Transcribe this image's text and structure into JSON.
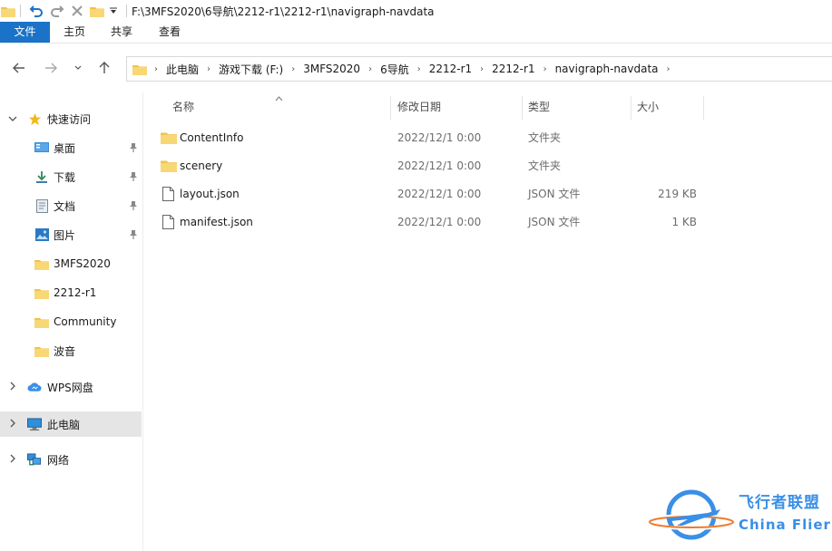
{
  "window": {
    "title_path": "F:\\3MFS2020\\6导航\\2212-r1\\2212-r1\\navigraph-navdata"
  },
  "ribbon": {
    "tabs": [
      {
        "label": "文件"
      },
      {
        "label": "主页"
      },
      {
        "label": "共享"
      },
      {
        "label": "查看"
      }
    ]
  },
  "address": {
    "breadcrumbs": [
      "此电脑",
      "游戏下载 (F:)",
      "3MFS2020",
      "6导航",
      "2212-r1",
      "2212-r1",
      "navigraph-navdata"
    ]
  },
  "sidebar": {
    "quick_access": "快速访问",
    "items": [
      {
        "label": "桌面",
        "icon": "desktop-icon",
        "pinned": true
      },
      {
        "label": "下载",
        "icon": "download-icon",
        "pinned": true
      },
      {
        "label": "文档",
        "icon": "document-icon",
        "pinned": true
      },
      {
        "label": "图片",
        "icon": "picture-icon",
        "pinned": true
      },
      {
        "label": "3MFS2020",
        "icon": "folder-icon",
        "pinned": false
      },
      {
        "label": "2212-r1",
        "icon": "folder-icon",
        "pinned": false
      },
      {
        "label": "Community",
        "icon": "folder-icon",
        "pinned": false
      },
      {
        "label": "波音",
        "icon": "folder-icon",
        "pinned": false
      }
    ],
    "wps": "WPS网盘",
    "this_pc": "此电脑",
    "network": "网络"
  },
  "filelist": {
    "columns": {
      "name": "名称",
      "date": "修改日期",
      "type": "类型",
      "size": "大小"
    },
    "rows": [
      {
        "name": "ContentInfo",
        "date": "2022/12/1 0:00",
        "type": "文件夹",
        "size": "",
        "icon": "folder-icon"
      },
      {
        "name": "scenery",
        "date": "2022/12/1 0:00",
        "type": "文件夹",
        "size": "",
        "icon": "folder-icon"
      },
      {
        "name": "layout.json",
        "date": "2022/12/1 0:00",
        "type": "JSON 文件",
        "size": "219 KB",
        "icon": "file-icon"
      },
      {
        "name": "manifest.json",
        "date": "2022/12/1 0:00",
        "type": "JSON 文件",
        "size": "1 KB",
        "icon": "file-icon"
      }
    ]
  },
  "watermark": {
    "cn": "飞行者联盟",
    "en": "China Flier"
  },
  "colors": {
    "accent": "#1a73c8",
    "folder": "#f2c14e",
    "selection": "#e5e5e5",
    "watermark": "#3a8fe6"
  }
}
